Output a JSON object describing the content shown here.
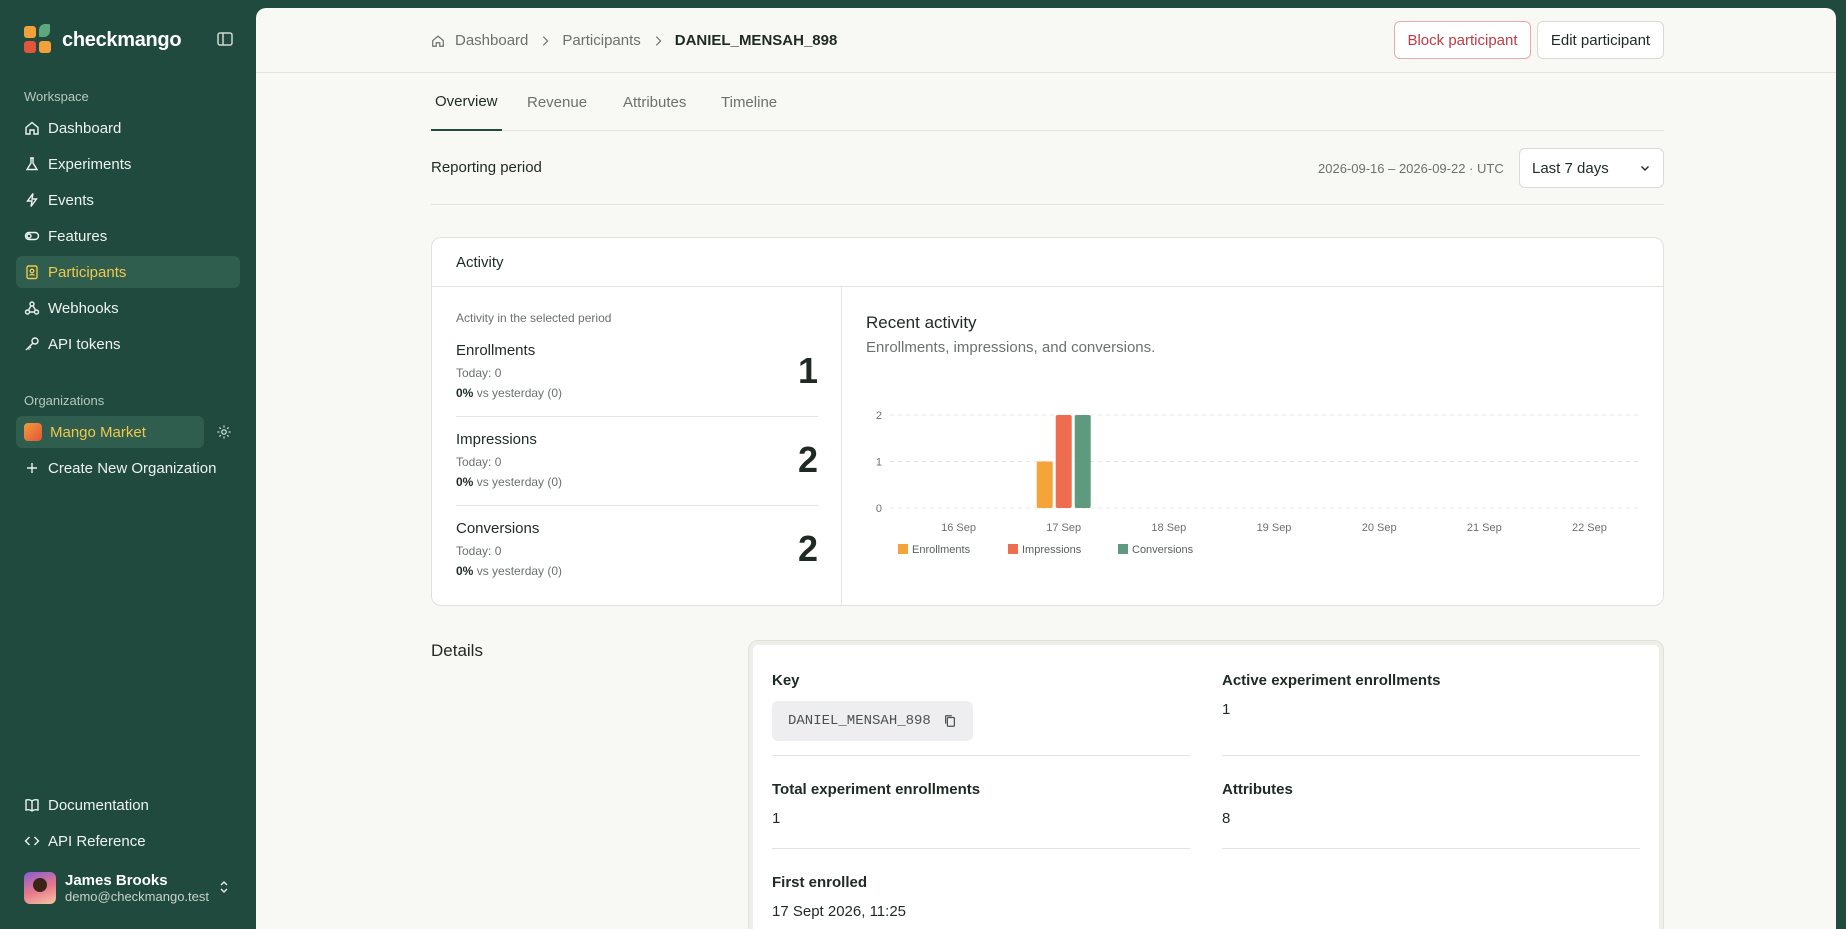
{
  "brand": {
    "name": "checkmango"
  },
  "sidebar": {
    "workspace_label": "Workspace",
    "items": [
      {
        "label": "Dashboard",
        "icon": "home-icon"
      },
      {
        "label": "Experiments",
        "icon": "flask-icon"
      },
      {
        "label": "Events",
        "icon": "bolt-icon"
      },
      {
        "label": "Features",
        "icon": "toggle-icon"
      },
      {
        "label": "Participants",
        "icon": "badge-icon"
      },
      {
        "label": "Webhooks",
        "icon": "webhook-icon"
      },
      {
        "label": "API tokens",
        "icon": "key-icon"
      }
    ],
    "active": "Participants",
    "organizations_label": "Organizations",
    "org_name": "Mango Market",
    "create_org": "Create New Organization",
    "docs": "Documentation",
    "api_ref": "API Reference"
  },
  "user": {
    "name": "James Brooks",
    "email": "demo@checkmango.test"
  },
  "breadcrumb": {
    "home": "Dashboard",
    "parent": "Participants",
    "current": "DANIEL_MENSAH_898"
  },
  "actions": {
    "block": "Block participant",
    "edit": "Edit participant"
  },
  "tabs": [
    "Overview",
    "Revenue",
    "Attributes",
    "Timeline"
  ],
  "period": {
    "label": "Reporting period",
    "range": "2026-09-16 – 2026-09-22 · UTC",
    "selected": "Last 7 days"
  },
  "activity": {
    "title": "Activity",
    "caption": "Activity in the selected period",
    "stats": [
      {
        "name": "Enrollments",
        "today": "Today: 0",
        "pct": "0%",
        "vs": "vs yesterday (0)",
        "value": "1"
      },
      {
        "name": "Impressions",
        "today": "Today: 0",
        "pct": "0%",
        "vs": "vs yesterday (0)",
        "value": "2"
      },
      {
        "name": "Conversions",
        "today": "Today: 0",
        "pct": "0%",
        "vs": "vs yesterday (0)",
        "value": "2"
      }
    ],
    "recent_title": "Recent activity",
    "recent_subtitle": "Enrollments, impressions, and conversions."
  },
  "chart_data": {
    "type": "bar",
    "categories": [
      "16 Sep",
      "17 Sep",
      "18 Sep",
      "19 Sep",
      "20 Sep",
      "21 Sep",
      "22 Sep"
    ],
    "series": [
      {
        "name": "Enrollments",
        "color": "#f5a43a",
        "values": [
          0,
          1,
          0,
          0,
          0,
          0,
          0
        ]
      },
      {
        "name": "Impressions",
        "color": "#ee6d4f",
        "values": [
          0,
          2,
          0,
          0,
          0,
          0,
          0
        ]
      },
      {
        "name": "Conversions",
        "color": "#5f9a80",
        "values": [
          0,
          2,
          0,
          0,
          0,
          0,
          0
        ]
      }
    ],
    "ylim": [
      0,
      2
    ],
    "yticks": [
      "0",
      "1",
      "2"
    ],
    "grid": true,
    "legend": "bottom-left"
  },
  "details": {
    "title": "Details",
    "key_label": "Key",
    "key_value": "DANIEL_MENSAH_898",
    "active_label": "Active experiment enrollments",
    "active_value": "1",
    "total_label": "Total experiment enrollments",
    "total_value": "1",
    "attributes_label": "Attributes",
    "attributes_value": "8",
    "first_label": "First enrolled",
    "first_value": "17 Sept 2026, 11:25"
  }
}
